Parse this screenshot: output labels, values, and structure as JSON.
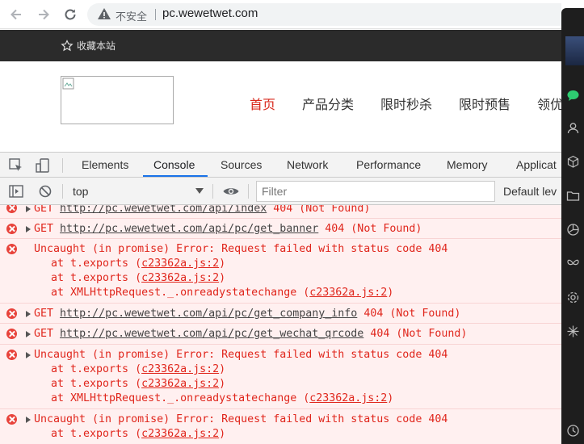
{
  "browser": {
    "security_label": "不安全",
    "url": "pc.wewetwet.com"
  },
  "site": {
    "favorite_label": "收藏本站",
    "nav": [
      "首页",
      "产品分类",
      "限时秒杀",
      "限时预售",
      "领优"
    ]
  },
  "devtools": {
    "tabs": [
      "Elements",
      "Console",
      "Sources",
      "Network",
      "Performance",
      "Memory",
      "Applicat"
    ],
    "active_tab": "Console",
    "context": "top",
    "filter_placeholder": "Filter",
    "levels_label": "Default lev"
  },
  "console": {
    "messages": [
      {
        "method": "GET",
        "url": "http://pc.wewetwet.com/api/index",
        "status": "404 (Not Found)"
      },
      {
        "method": "GET",
        "url": "http://pc.wewetwet.com/api/pc/get_banner",
        "status": "404 (Not Found)"
      },
      {
        "text": "Uncaught (in promise) Error: Request failed with status code 404",
        "stack": [
          {
            "fn": "at t.exports (",
            "src": "c23362a.js:2",
            "end": ")"
          },
          {
            "fn": "at t.exports (",
            "src": "c23362a.js:2",
            "end": ")"
          },
          {
            "fn": "at XMLHttpRequest._.onreadystatechange (",
            "src": "c23362a.js:2",
            "end": ")"
          }
        ]
      },
      {
        "method": "GET",
        "url": "http://pc.wewetwet.com/api/pc/get_company_info",
        "status": "404 (Not Found)"
      },
      {
        "method": "GET",
        "url": "http://pc.wewetwet.com/api/pc/get_wechat_qrcode",
        "status": "404 (Not Found)"
      },
      {
        "text": "Uncaught (in promise) Error: Request failed with status code 404",
        "stack": [
          {
            "fn": "at t.exports (",
            "src": "c23362a.js:2",
            "end": ")"
          },
          {
            "fn": "at t.exports (",
            "src": "c23362a.js:2",
            "end": ")"
          },
          {
            "fn": "at XMLHttpRequest._.onreadystatechange (",
            "src": "c23362a.js:2",
            "end": ")"
          }
        ]
      },
      {
        "text": "Uncaught (in promise) Error: Request failed with status code 404",
        "stack": [
          {
            "fn": "at t.exports (",
            "src": "c23362a.js:2",
            "end": ")"
          }
        ]
      }
    ]
  },
  "colors": {
    "error_text": "#e0261c",
    "error_bg": "#fff0f0",
    "nav_active": "#d9291c",
    "tab_accent": "#1a73e8"
  }
}
